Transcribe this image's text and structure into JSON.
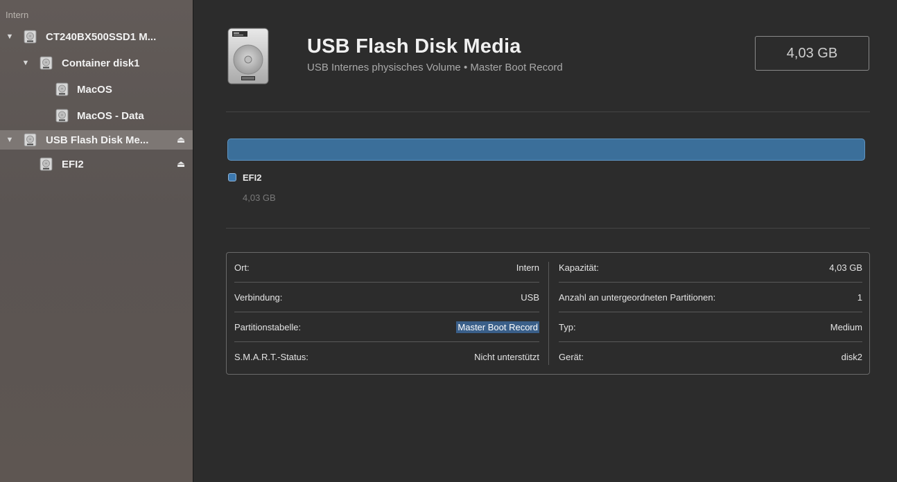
{
  "sidebar": {
    "section_label": "Intern",
    "items": [
      {
        "label": "CT240BX500SSD1 M...",
        "expanded": true,
        "eject": false,
        "selected": false
      },
      {
        "label": "Container disk1",
        "expanded": true,
        "eject": false,
        "selected": false
      },
      {
        "label": "MacOS",
        "expanded": false,
        "eject": false,
        "selected": false
      },
      {
        "label": "MacOS - Data",
        "expanded": false,
        "eject": false,
        "selected": false
      },
      {
        "label": "USB Flash Disk Me...",
        "expanded": true,
        "eject": true,
        "selected": true
      },
      {
        "label": "EFI2",
        "expanded": false,
        "eject": true,
        "selected": false
      }
    ],
    "triangle_glyph": "▼",
    "eject_glyph": "⏏",
    "icons": {
      "disk": "hard-disk-icon",
      "eject": "eject-icon",
      "disclosure": "disclosure-triangle-icon"
    }
  },
  "header": {
    "title": "USB Flash Disk Media",
    "subtitle": "USB Internes physisches Volume • Master Boot Record",
    "capacity": "4,03 GB"
  },
  "partition": {
    "color": "#3b6f9a",
    "legend_name": "EFI2",
    "legend_size": "4,03 GB",
    "fill_fraction": 1.0
  },
  "info": {
    "left": [
      {
        "key": "Ort:",
        "value": "Intern",
        "highlight": false
      },
      {
        "key": "Verbindung:",
        "value": "USB",
        "highlight": false
      },
      {
        "key": "Partitionstabelle:",
        "value": "Master Boot Record",
        "highlight": true
      },
      {
        "key": "S.M.A.R.T.-Status:",
        "value": "Nicht unterstützt",
        "highlight": false
      }
    ],
    "right": [
      {
        "key": "Kapazität:",
        "value": "4,03 GB",
        "highlight": false
      },
      {
        "key": "Anzahl an untergeordneten Partitionen:",
        "value": "1",
        "highlight": false
      },
      {
        "key": "Typ:",
        "value": "Medium",
        "highlight": false
      },
      {
        "key": "Gerät:",
        "value": "disk2",
        "highlight": false
      }
    ]
  },
  "colors": {
    "sidebar_bg": "#5e5754",
    "sidebar_selected": "#7d7774",
    "main_bg": "#2c2c2c",
    "partition_blue": "#3b6f9a",
    "selection_highlight": "#3a5f89"
  }
}
